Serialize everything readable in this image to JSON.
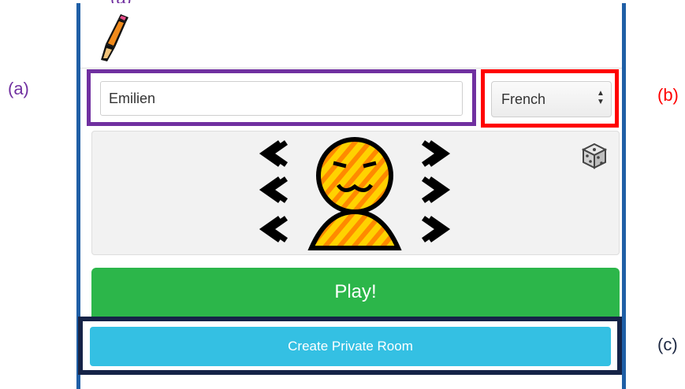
{
  "annotations": {
    "top": "(a)",
    "a": "(a)",
    "b": "(b)",
    "c": "(c)"
  },
  "name_input": {
    "value": "Emilien"
  },
  "language": {
    "selected": "French"
  },
  "play_button": {
    "label": "Play!"
  },
  "private_room_button": {
    "label": "Create Private Room"
  },
  "colors": {
    "annotation_a": "#7030a0",
    "annotation_b": "#ff0000",
    "annotation_c": "#152347",
    "panel_border": "#1f5fa6",
    "play": "#2cb64a",
    "private_room": "#34c0e3"
  },
  "icons": {
    "logo": "pencil-icon",
    "randomize": "dice-icon",
    "prev_eyes": "chevron-left-icon",
    "next_eyes": "chevron-right-icon"
  }
}
